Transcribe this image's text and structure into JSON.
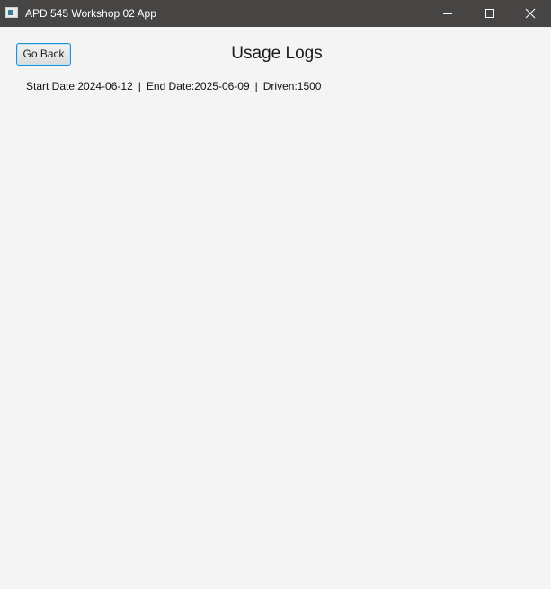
{
  "window": {
    "title": "APD 545 Workshop 02 App",
    "controls": [
      "minimize-icon",
      "maximize-icon",
      "close-icon"
    ]
  },
  "header": {
    "back_label": "Go Back",
    "title": "Usage Logs"
  },
  "summary": {
    "start_label": "Start Date:",
    "start_value": "2024-06-12",
    "separator": "|",
    "end_label": "End Date:",
    "end_value": "2025-06-09",
    "driven_label": "Driven:",
    "driven_value": "1500"
  },
  "colors": {
    "titlebar": "#474543",
    "background": "#f4f4f4",
    "focus_border": "#1e8fd1"
  }
}
